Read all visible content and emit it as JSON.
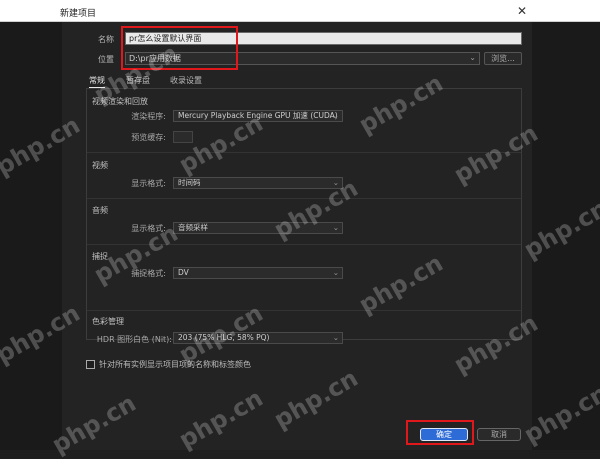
{
  "window": {
    "title": "新建项目",
    "close_glyph": "✕"
  },
  "form": {
    "name_label": "名称",
    "name_value": "pr怎么设置默认界面",
    "location_label": "位置",
    "location_value": "D:\\pr应用数据",
    "browse_label": "浏览..."
  },
  "tabs": [
    {
      "label": "常规"
    },
    {
      "label": "暂存盘"
    },
    {
      "label": "收录设置"
    }
  ],
  "sections": {
    "render": {
      "title": "视频渲染和回放",
      "renderer_label": "渲染程序:",
      "renderer_value": "Mercury Playback Engine GPU 加速 (CUDA)",
      "preview_cache_label": "预览缓存:"
    },
    "video": {
      "title": "视频",
      "display_format_label": "显示格式:",
      "display_format_value": "时间码"
    },
    "audio": {
      "title": "音频",
      "display_format_label": "显示格式:",
      "display_format_value": "音频采样"
    },
    "capture": {
      "title": "捕捉",
      "capture_format_label": "捕捉格式:",
      "capture_format_value": "DV"
    },
    "color": {
      "title": "色彩管理",
      "hdr_label": "HDR 图形白色 (Nit):",
      "hdr_value": "203 (75% HLG, 58% PQ)"
    }
  },
  "checkbox": {
    "label": "针对所有实例显示项目项的名称和标签颜色",
    "checked": false
  },
  "buttons": {
    "ok": "确定",
    "cancel": "取消"
  },
  "watermark": {
    "text": "php.cn"
  },
  "colors": {
    "ok_button": "#2d6bd6",
    "annotation_red": "#e0181b",
    "dialog_bg": "#232323"
  }
}
